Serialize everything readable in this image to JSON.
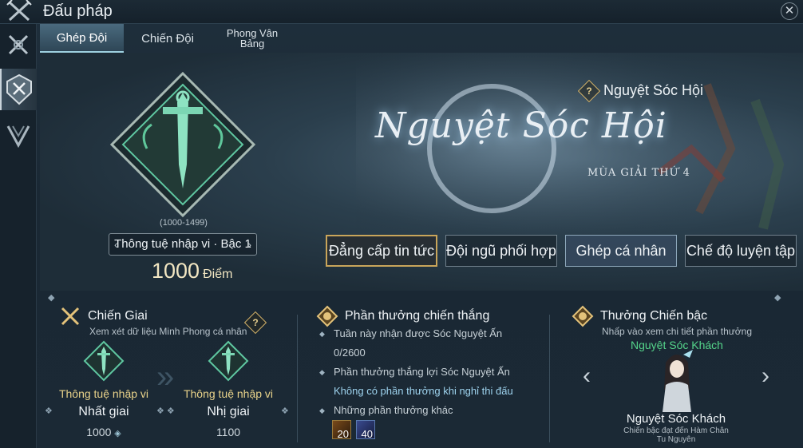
{
  "window": {
    "title": "Đấu pháp",
    "close_icon": "close-icon"
  },
  "rail": {
    "items": [
      {
        "icon": "crossed-swords-icon"
      },
      {
        "icon": "rank-shield-icon",
        "active": true
      },
      {
        "icon": "chevron-emblem-icon"
      }
    ]
  },
  "tabs": [
    {
      "label": "Ghép Đội",
      "active": true
    },
    {
      "label": "Chiến Đội"
    },
    {
      "label": "Phong Vân",
      "label2": "Bảng"
    }
  ],
  "rank": {
    "range": "(1000-1499)",
    "name": "Thông tuệ nhập vi · Bậc 1",
    "points": "1000",
    "points_unit": "Điểm"
  },
  "mode": {
    "link_label": "Nguyệt Sóc Hội",
    "logo_text": "Nguyệt Sóc Hội",
    "season": "MÙA GIẢI THỨ 4"
  },
  "mode_buttons": [
    {
      "label": "Đẳng cấp tin tức"
    },
    {
      "label": "Đội ngũ phối hợp"
    },
    {
      "label": "Ghép cá nhân"
    },
    {
      "label": "Chế độ luyện tập"
    }
  ],
  "chien_giai": {
    "title": "Chiến Giai",
    "subtitle": "Xem xét dữ liệu Minh Phong cá nhân",
    "tiers": [
      {
        "name": "Thông tuệ nhập vi",
        "grade": "Nhất giai",
        "points": "1000"
      },
      {
        "name": "Thông tuệ nhập vi",
        "grade": "Nhị giai",
        "points": "1100"
      }
    ]
  },
  "victory_rewards": {
    "title": "Phần thưởng chiến thắng",
    "lines": [
      "Tuần này nhận được Sóc Nguyệt Ấn",
      "0/2600",
      "Phần thưởng thắng lợi Sóc Nguyệt Ấn",
      "Không có phần thưởng khi nghỉ thi đấu",
      "Những phần thưởng khác"
    ],
    "items": [
      {
        "count": "20"
      },
      {
        "count": "40"
      }
    ]
  },
  "rank_reward": {
    "title": "Thưởng Chiến bậc",
    "subtitle": "Nhấp vào xem chi tiết phần thưởng",
    "highlight": "Nguyệt Sóc Khách",
    "name": "Nguyệt Sóc Khách",
    "desc": "Chiến bậc  đạt đến Hàm Chân Tu Nguyên"
  },
  "colors": {
    "accent_gold": "#c9a55a",
    "green": "#54d48a",
    "background": "#1a2834"
  }
}
